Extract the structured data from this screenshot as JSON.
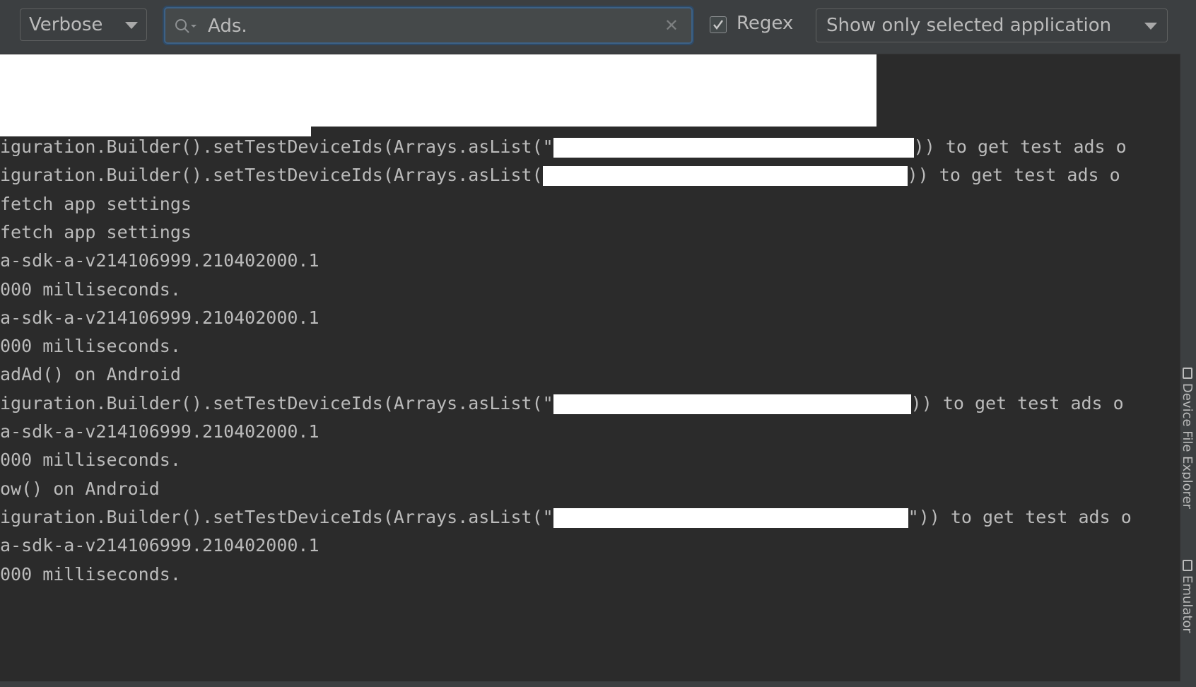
{
  "toolbar": {
    "log_level": "Verbose",
    "search_value": "Ads.",
    "regex_checked": true,
    "regex_label": "Regex",
    "app_filter": "Show only selected application"
  },
  "log_lines": [
    {
      "before": "iguration.Builder().setTestDeviceIds(Arrays.asList(\"",
      "after": ")) to get test ads o",
      "redacted": true
    },
    {
      "before": "iguration.Builder().setTestDeviceIds(Arrays.asList(",
      "after": ")) to get test ads o",
      "redacted": true
    },
    {
      "before": "fetch app settings",
      "after": "",
      "redacted": false
    },
    {
      "before": "fetch app settings",
      "after": "",
      "redacted": false
    },
    {
      "before": "a-sdk-a-v214106999.210402000.1",
      "after": "",
      "redacted": false
    },
    {
      "before": "000 milliseconds.",
      "after": "",
      "redacted": false
    },
    {
      "before": "a-sdk-a-v214106999.210402000.1",
      "after": "",
      "redacted": false
    },
    {
      "before": "000 milliseconds.",
      "after": "",
      "redacted": false
    },
    {
      "before": "adAd() on Android",
      "after": "",
      "redacted": false
    },
    {
      "before": "iguration.Builder().setTestDeviceIds(Arrays.asList(\"",
      "after": ")) to get test ads o",
      "redacted": true
    },
    {
      "before": "a-sdk-a-v214106999.210402000.1",
      "after": "",
      "redacted": false
    },
    {
      "before": "000 milliseconds.",
      "after": "",
      "redacted": false
    },
    {
      "before": "ow() on Android",
      "after": "",
      "redacted": false
    },
    {
      "before": "iguration.Builder().setTestDeviceIds(Arrays.asList(\"",
      "after": "\")) to get test ads o",
      "redacted": true
    },
    {
      "before": "a-sdk-a-v214106999.210402000.1",
      "after": "",
      "redacted": false
    },
    {
      "before": "000 milliseconds.",
      "after": "",
      "redacted": false
    }
  ],
  "side_tools": {
    "device_file_explorer": "Device File Explorer",
    "emulator": "Emulator"
  },
  "colors": {
    "background": "#2b2b2b",
    "toolbar": "#3c3f41",
    "text": "#bbbbbb",
    "focus_border": "#3d6185"
  }
}
